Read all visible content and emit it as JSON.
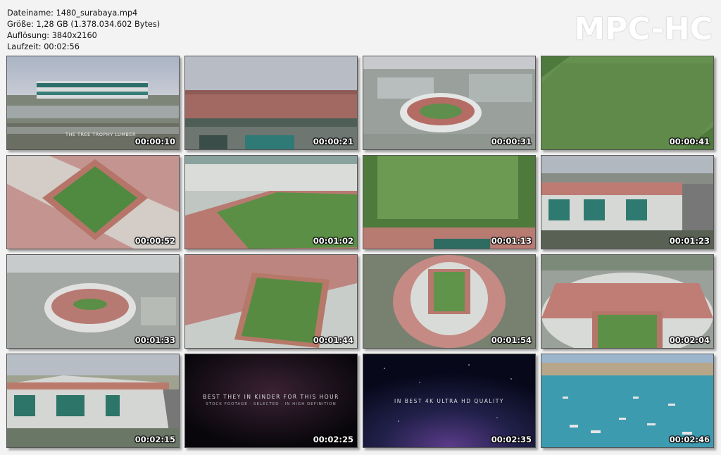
{
  "file_info": {
    "filename": "Dateiname: 1480_surabaya.mp4",
    "size": "Größe: 1,28 GB (1.378.034.602 Bytes)",
    "resolution": "Auflösung: 3840x2160",
    "duration": "Laufzeit: 00:02:56"
  },
  "logo": "MPC-HC",
  "thumbnails": [
    {
      "time": "00:00:10",
      "icon": "stadium-exterior-image",
      "caption": "THE TREE TROPHY LUMBER"
    },
    {
      "time": "00:00:21",
      "icon": "stadium-roof-image"
    },
    {
      "time": "00:00:31",
      "icon": "stadium-aerial-image"
    },
    {
      "time": "00:00:41",
      "icon": "football-pitch-image"
    },
    {
      "time": "00:00:52",
      "icon": "stadium-bowl-image"
    },
    {
      "time": "00:01:02",
      "icon": "stadium-stands-image"
    },
    {
      "time": "00:01:13",
      "icon": "football-pitch-image"
    },
    {
      "time": "00:01:23",
      "icon": "stadium-facade-image"
    },
    {
      "time": "00:01:33",
      "icon": "stadium-aerial-image"
    },
    {
      "time": "00:01:44",
      "icon": "stadium-bowl-image"
    },
    {
      "time": "00:01:54",
      "icon": "stadium-top-down-image"
    },
    {
      "time": "00:02:04",
      "icon": "stadium-interior-image"
    },
    {
      "time": "00:02:15",
      "icon": "stadium-facade-image"
    },
    {
      "time": "00:02:25",
      "icon": "title-card-image",
      "caption": "BEST THEY IN KINDER FOR THIS HOUR",
      "caption2": "STOCK FOOTAGE · SELECTED · IN HIGH DEFINITION"
    },
    {
      "time": "00:02:35",
      "icon": "title-card-image",
      "caption": "IN BEST 4K ULTRA HD QUALITY"
    },
    {
      "time": "00:02:46",
      "icon": "harbor-boats-image"
    }
  ]
}
